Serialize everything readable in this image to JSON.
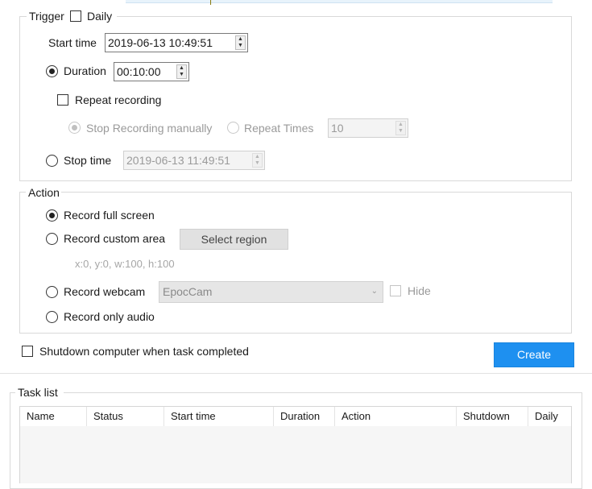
{
  "trigger": {
    "title": "Trigger",
    "daily_label": "Daily",
    "start_time_label": "Start time",
    "start_time_value": "2019-06-13 10:49:51",
    "duration_label": "Duration",
    "duration_value": "00:10:00",
    "repeat_label": "Repeat recording",
    "stop_manually_label": "Stop Recording manually",
    "repeat_times_label": "Repeat Times",
    "repeat_times_value": "10",
    "stop_time_label": "Stop time",
    "stop_time_value": "2019-06-13 11:49:51"
  },
  "action": {
    "title": "Action",
    "full_screen_label": "Record full screen",
    "custom_area_label": "Record custom area",
    "select_region_label": "Select region",
    "region_hint": "x:0, y:0, w:100, h:100",
    "webcam_label": "Record webcam",
    "webcam_value": "EpocCam",
    "hide_label": "Hide",
    "audio_label": "Record only audio"
  },
  "shutdown_label": "Shutdown computer when task completed",
  "create_label": "Create",
  "task_list": {
    "title": "Task list",
    "columns": [
      "Name",
      "Status",
      "Start time",
      "Duration",
      "Action",
      "Shutdown",
      "Daily"
    ]
  },
  "icons": {
    "spin": "spin-arrows-icon",
    "dropdown": "chevron-down-icon"
  }
}
